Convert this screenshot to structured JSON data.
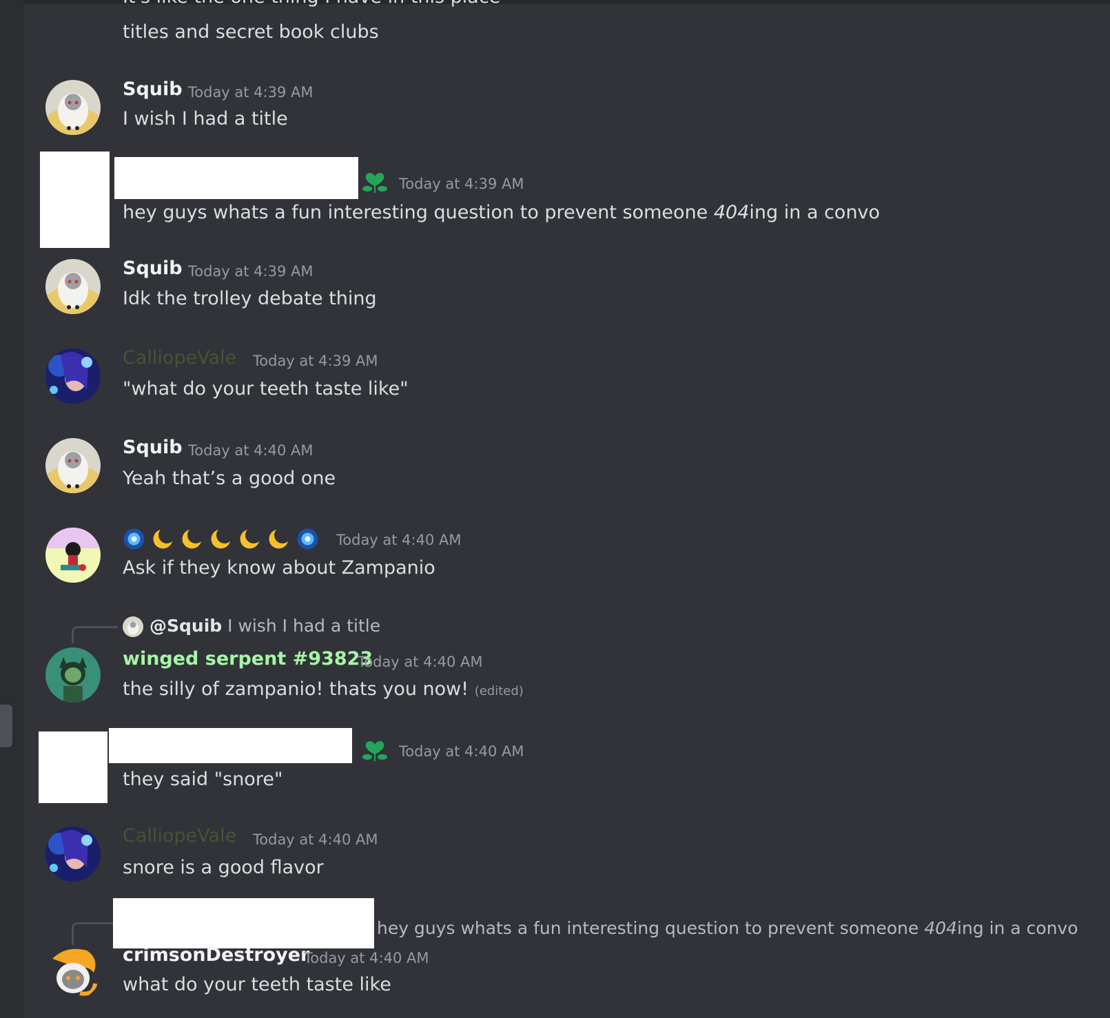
{
  "partial_top": "It's like the one thing I have in this place",
  "messages": [
    {
      "author": "",
      "time": "",
      "text": "titles and secret book clubs"
    },
    {
      "author": "Squib",
      "time": "Today at 4:39 AM",
      "text": "I wish I had a title"
    },
    {
      "author": "",
      "time": "Today at 4:39 AM",
      "text_a": "hey guys whats a fun interesting question to prevent someone ",
      "text_em": "404",
      "text_b": "ing in a convo"
    },
    {
      "author": "Squib",
      "time": "Today at 4:39 AM",
      "text": "Idk the trolley debate thing"
    },
    {
      "author": "CalliopeVale",
      "time": "Today at 4:39 AM",
      "text": "\"what do your teeth taste like\""
    },
    {
      "author": "Squib",
      "time": "Today at 4:40 AM",
      "text": "Yeah that’s a good one"
    },
    {
      "author": "",
      "time": "Today at 4:40 AM",
      "text": "Ask if they know about Zampanio"
    },
    {
      "reply_author": "@Squib",
      "reply_text": "I wish I had a title",
      "author": "winged serpent #93823",
      "time": "Today at 4:40 AM",
      "text": "the silly of zampanio! thats you now!",
      "edited": "(edited)"
    },
    {
      "author": "",
      "time": "Today at 4:40 AM",
      "text": "they said \"snore\""
    },
    {
      "author": "CalliopeVale",
      "time": "Today at 4:40 AM",
      "text": "snore is a good flavor"
    },
    {
      "reply_text_a": "hey guys whats a fun interesting question to prevent someone ",
      "reply_text_em": "404",
      "reply_text_b": "ing in a convo",
      "author": "crimsonDestroyer",
      "time": "Today at 4:40 AM",
      "text": "what do your teeth taste like"
    }
  ],
  "icons": {
    "role_icon": "green-flower-heart-icon",
    "name_emoji": [
      "blue-swirl",
      "crescent-moon",
      "crescent-moon",
      "crescent-moon",
      "crescent-moon",
      "crescent-moon",
      "blue-swirl"
    ]
  },
  "colors": {
    "background": "#313338",
    "calliope_name": "#4a5236",
    "serpent_name": "#a6f5a6",
    "role_icon": "#23a55a"
  }
}
